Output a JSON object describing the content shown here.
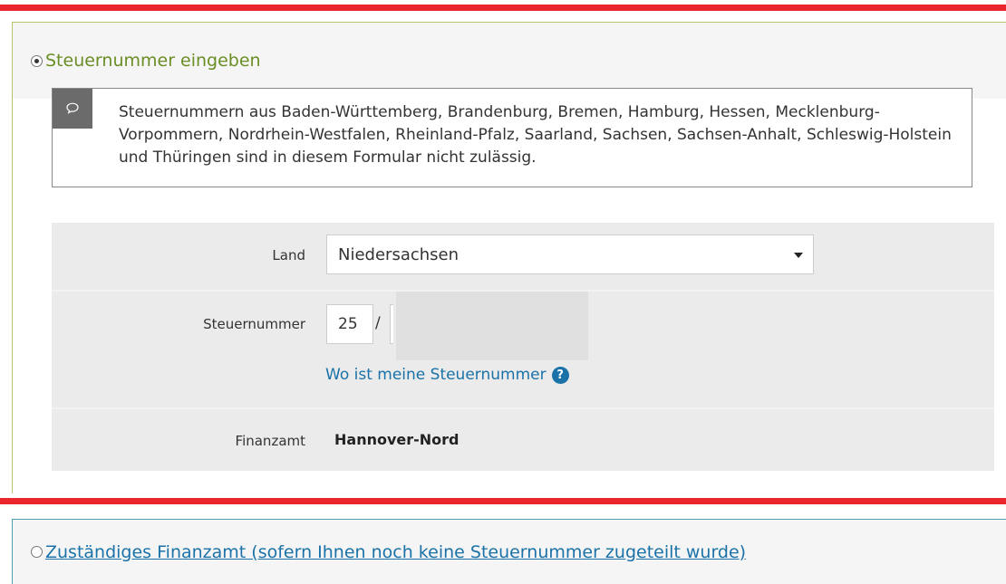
{
  "options": {
    "enter_tax_number": {
      "label": "Steuernummer eingeben",
      "selected": true
    },
    "responsible_office": {
      "label": "Zuständiges Finanzamt (sofern Ihnen noch keine Steuernummer zugeteilt wurde)",
      "selected": false
    }
  },
  "notice": {
    "icon": "speech-bubble-icon",
    "text": "Steuernummern aus Baden-Württemberg, Brandenburg, Bremen, Hamburg, Hessen, Mecklenburg-Vorpommern, Nordrhein-Westfalen, Rheinland-Pfalz, Saarland, Sachsen, Sachsen-Anhalt, Schleswig-Holstein und Thüringen sind in diesem Formular nicht zulässig."
  },
  "form": {
    "land": {
      "label": "Land",
      "value": "Niedersachsen"
    },
    "steuernummer": {
      "label": "Steuernummer",
      "prefix": "25",
      "separator": "/",
      "help_link": "Wo ist meine Steuernummer",
      "help_icon": "question-circle-icon"
    },
    "finanzamt": {
      "label": "Finanzamt",
      "value": "Hannover-Nord"
    }
  },
  "colors": {
    "highlight": "#e8262b",
    "selected_title": "#6a8e23",
    "link": "#1a72a8"
  }
}
